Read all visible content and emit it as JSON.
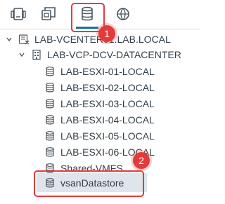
{
  "tabs": [
    {
      "name": "hosts-and-clusters",
      "icon": "hosts-clusters-icon"
    },
    {
      "name": "vms-and-templates",
      "icon": "vms-templates-icon"
    },
    {
      "name": "storage",
      "icon": "storage-icon",
      "active": true
    },
    {
      "name": "networking",
      "icon": "networking-icon"
    }
  ],
  "tree": {
    "vcenter": "LAB-VCENTER01.LAB.LOCAL",
    "datacenter": "LAB-VCP-DCV-DATACENTER",
    "datastores": [
      "LAB-ESXI-01-LOCAL",
      "LAB-ESXI-02-LOCAL",
      "LAB-ESXI-03-LOCAL",
      "LAB-ESXI-04-LOCAL",
      "LAB-ESXI-05-LOCAL",
      "LAB-ESXI-06-LOCAL",
      "Shared-VMFS",
      "vsanDatastore"
    ]
  },
  "callouts": {
    "first": "1",
    "second": "2"
  },
  "colors": {
    "accent": "#1d6fa8",
    "callout": "#e23b3b",
    "text": "#333f48"
  }
}
